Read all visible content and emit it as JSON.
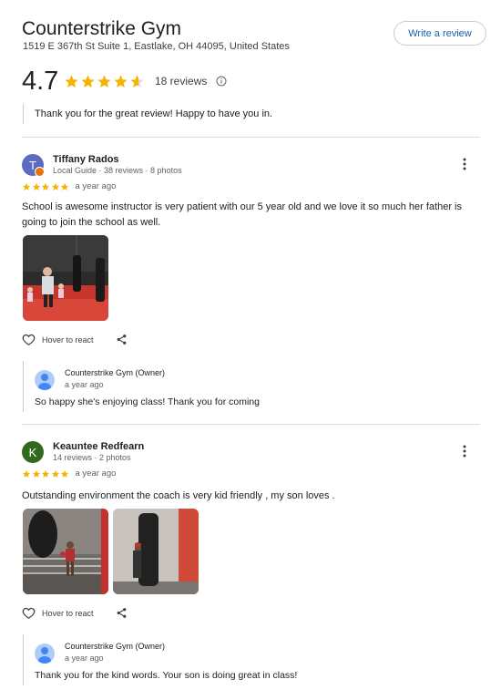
{
  "business": {
    "name": "Counterstrike Gym",
    "address": "1519 E 367th St Suite 1, Eastlake, OH 44095, United States",
    "write_review_label": "Write a review",
    "rating": "4.7",
    "rating_value": 4.7,
    "review_count": "18 reviews"
  },
  "top_reply": {
    "text": "Thank you for the great review! Happy to have you in."
  },
  "reviews": [
    {
      "name": "Tiffany Rados",
      "initial": "T",
      "avatar_color": "#5c6bc0",
      "meta": "Local Guide · 38 reviews · 8 photos",
      "stars": 5,
      "time": "a year ago",
      "text": "School is awesome instructor is very patient with our 5 year old and we love it so much her father is going to join the school as well.",
      "react_label": "Hover to react",
      "photos": [
        "kids-class-photo"
      ],
      "owner_reply": {
        "name": "Counterstrike Gym (Owner)",
        "time": "a year ago",
        "text": "So happy she's enjoying class! Thank you for coming"
      }
    },
    {
      "name": "Keauntee Redfearn",
      "initial": "K",
      "avatar_color": "#33691e",
      "meta": "14 reviews · 2 photos",
      "stars": 5,
      "time": "a year ago",
      "text": "Outstanding environment the coach is very kid friendly , my son loves .",
      "react_label": "Hover to react",
      "photos": [
        "boxing-ring-photo",
        "heavy-bag-photo"
      ],
      "owner_reply": {
        "name": "Counterstrike Gym (Owner)",
        "time": "a year ago",
        "text": "Thank you for the kind words. Your son is doing great in class!"
      }
    }
  ],
  "colors": {
    "star": "#f4b400",
    "link": "#1a5fb4",
    "divider": "#dadce0"
  }
}
